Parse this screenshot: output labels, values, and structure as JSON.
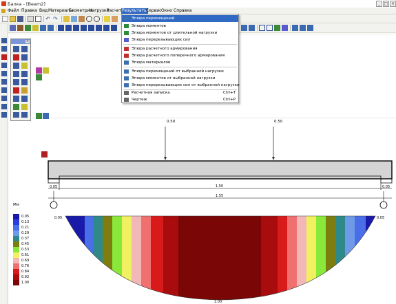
{
  "window": {
    "title": "Балка - [Beam2]",
    "min": "_",
    "max": "□",
    "close": "×"
  },
  "menubar": {
    "items": [
      {
        "label": "Файл"
      },
      {
        "label": "Правка"
      },
      {
        "label": "Вид"
      },
      {
        "label": "Материалы"
      },
      {
        "label": "Геометрия"
      },
      {
        "label": "Нагрузки"
      },
      {
        "label": "Расчет"
      },
      {
        "label": "Результаты"
      },
      {
        "label": "Сервис"
      },
      {
        "label": "Окно"
      },
      {
        "label": "Справка"
      }
    ]
  },
  "results_menu": {
    "items": [
      {
        "label": "Эпюра перемещений",
        "shortcut": "",
        "icon": "displacement-diagram-icon",
        "color": "#3a6fb0"
      },
      {
        "label": "Эпюра моментов",
        "shortcut": "",
        "icon": "moment-diagram-icon",
        "color": "#2e8b3a"
      },
      {
        "label": "Эпюра моментов от длительной нагрузки",
        "shortcut": "",
        "icon": "long-term-moment-icon",
        "color": "#2e8b3a"
      },
      {
        "label": "Эпюра перерезывающих сил",
        "shortcut": "",
        "icon": "shear-force-icon",
        "color": "#5a5ad0"
      },
      {
        "label": "Эпюра расчетного армирования",
        "shortcut": "",
        "icon": "reinforcement-icon",
        "color": "#c03030"
      },
      {
        "label": "Эпюра расчетного поперечного армирования",
        "shortcut": "",
        "icon": "transverse-reinforcement-icon",
        "color": "#c03030"
      },
      {
        "label": "Эпюра материалов",
        "shortcut": "",
        "icon": "materials-diagram-icon",
        "color": "#3a6fb0"
      },
      {
        "label": "Эпюра перемещений от выбранной нагрузки",
        "shortcut": "",
        "icon": "selected-load-displacement-icon",
        "color": "#3a6fb0"
      },
      {
        "label": "Эпюра моментов от выбранной нагрузки",
        "shortcut": "",
        "icon": "selected-load-moment-icon",
        "color": "#3a6fb0"
      },
      {
        "label": "Эпюра перерезывающих сил от выбранной нагрузки",
        "shortcut": "",
        "icon": "selected-load-shear-icon",
        "color": "#3a6fb0"
      },
      {
        "label": "Расчетная записка",
        "shortcut": "Ctrl+T",
        "icon": "report-icon",
        "color": "#666666"
      },
      {
        "label": "Чертеж",
        "shortcut": "Ctrl+P",
        "icon": "drawing-icon",
        "color": "#666666"
      }
    ]
  },
  "beam": {
    "load_labels": [
      "0.50",
      "0.50"
    ],
    "support_offset_left": "0.05",
    "support_offset_right": "0.05",
    "span_inner": "1.50",
    "span_total": "1.55"
  },
  "diagram": {
    "left_label": "0.05",
    "right_label": "0.05",
    "max_label": "1.00"
  },
  "legend": {
    "title": "Мм",
    "items": [
      {
        "value": "0.05",
        "color": "#1a1aaa"
      },
      {
        "value": "0.13",
        "color": "#2a3ee0"
      },
      {
        "value": "0.21",
        "color": "#4a6ee8"
      },
      {
        "value": "0.29",
        "color": "#6f9ae8"
      },
      {
        "value": "0.37",
        "color": "#2e8a8a"
      },
      {
        "value": "0.45",
        "color": "#7e7e10"
      },
      {
        "value": "0.53",
        "color": "#8ae83a"
      },
      {
        "value": "0.61",
        "color": "#f0f060"
      },
      {
        "value": "0.69",
        "color": "#f2b8b8"
      },
      {
        "value": "0.76",
        "color": "#f07070"
      },
      {
        "value": "0.84",
        "color": "#d81a1a"
      },
      {
        "value": "0.92",
        "color": "#a80c0c"
      },
      {
        "value": "1.00",
        "color": "#7a0606"
      }
    ]
  },
  "toolbar_icons": {
    "row1": [
      "new-file-icon",
      "open-icon",
      "save-icon",
      "print-icon",
      "preview-icon",
      "undo-icon",
      "redo-icon",
      "cut-icon",
      "copy-icon",
      "paste-icon",
      "zoom-icon",
      "search-icon",
      "pencil-icon",
      "eraser-icon"
    ],
    "row2": [
      "beam-icon",
      "section-icon",
      "material-icon",
      "load-icon",
      "support-icon",
      "hinge-icon",
      "clamp-icon",
      "fixed-icon",
      "span-icon",
      "joint-icon",
      "force-icon",
      "moment-icon",
      "dist-load-icon",
      "calc-icon",
      "grid-icon"
    ]
  }
}
